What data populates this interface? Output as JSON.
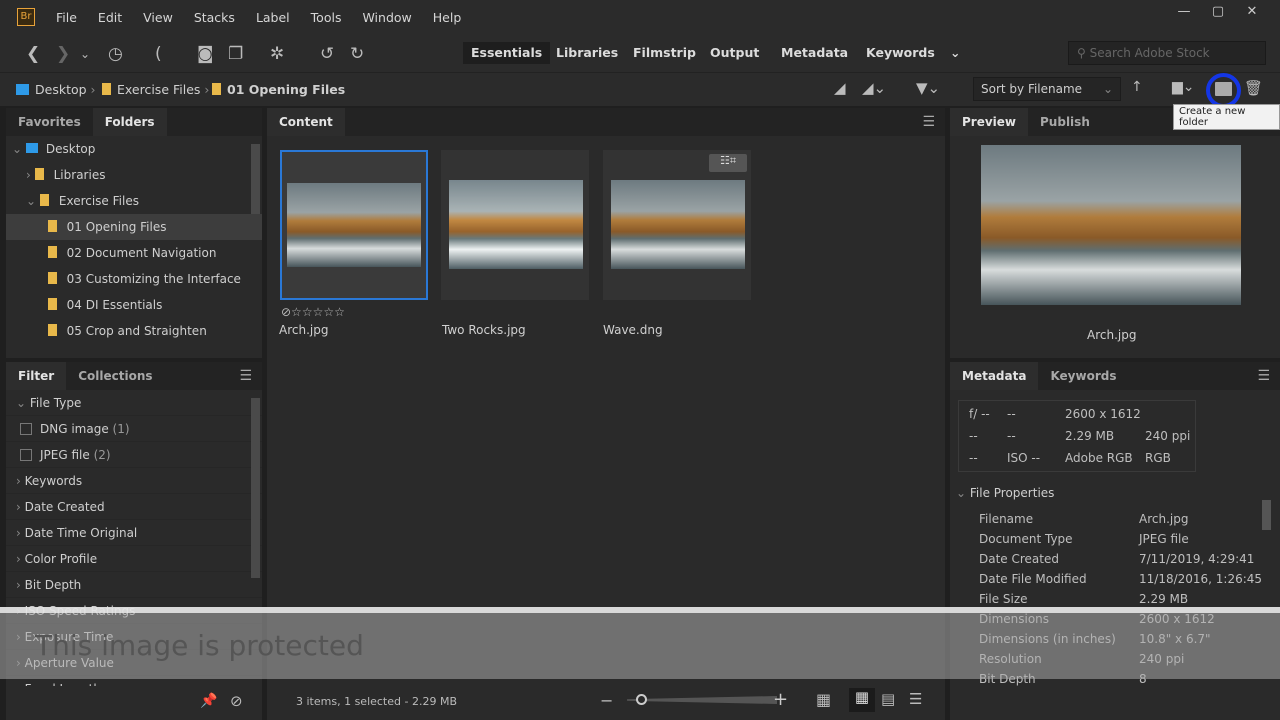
{
  "app": {
    "logo": "Br",
    "menu": [
      "File",
      "Edit",
      "View",
      "Stacks",
      "Label",
      "Tools",
      "Window",
      "Help"
    ]
  },
  "window_controls": {
    "minimize": "—",
    "maximize": "▢",
    "close": "✕"
  },
  "toolbar": {
    "workspaces": [
      "Essentials",
      "Libraries",
      "Filmstrip",
      "Output",
      "Metadata",
      "Keywords"
    ],
    "active_workspace": "Essentials",
    "search_placeholder": "Search Adobe Stock"
  },
  "breadcrumb": [
    "Desktop",
    "Exercise Files",
    "01 Opening Files"
  ],
  "sort": {
    "label": "Sort by Filename"
  },
  "tooltip": "Create a new folder",
  "left_panel": {
    "tabs": [
      "Favorites",
      "Folders"
    ],
    "active_tab": "Folders",
    "tree": [
      {
        "label": "Desktop",
        "level": 0,
        "expanded": true
      },
      {
        "label": "Libraries",
        "level": 1
      },
      {
        "label": "Exercise Files",
        "level": 1,
        "expanded": true
      },
      {
        "label": "01 Opening Files",
        "level": 2,
        "selected": true
      },
      {
        "label": "02 Document Navigation",
        "level": 2
      },
      {
        "label": "03 Customizing the Interface",
        "level": 2
      },
      {
        "label": "04 DI Essentials",
        "level": 2
      },
      {
        "label": "05 Crop and Straighten",
        "level": 2
      }
    ],
    "filter_tabs": [
      "Filter",
      "Collections"
    ],
    "filter_heading": "File Type",
    "file_types": [
      {
        "label": "DNG image",
        "count": "(1)"
      },
      {
        "label": "JPEG file",
        "count": "(2)"
      }
    ],
    "filter_groups": [
      "Keywords",
      "Date Created",
      "Date Time Original",
      "Color Profile",
      "Bit Depth",
      "ISO Speed Ratings",
      "Exposure Time",
      "Aperture Value",
      "Focal Length"
    ]
  },
  "content": {
    "title": "Content",
    "items": [
      {
        "name": "Arch.jpg",
        "selected": true,
        "rating": 0
      },
      {
        "name": "Two Rocks.jpg"
      },
      {
        "name": "Wave.dng",
        "badge": "adjusted-crop"
      }
    ],
    "status": "3 items, 1 selected - 2.29 MB",
    "thumbnail_size": 0.1
  },
  "preview": {
    "tabs": [
      "Preview",
      "Publish"
    ],
    "caption": "Arch.jpg"
  },
  "metadata": {
    "tabs": [
      "Metadata",
      "Keywords"
    ],
    "placard": {
      "aperture": "f/ --",
      "shutter": "--",
      "c1": "--",
      "c2": "--",
      "c3": "--",
      "iso": "ISO --",
      "dimensions": "2600 x 1612",
      "size": "2.29 MB",
      "resolution": "240 ppi",
      "profile": "Adobe RGB",
      "mode": "RGB"
    },
    "section": "File Properties",
    "props": [
      [
        "Filename",
        "Arch.jpg"
      ],
      [
        "Document Type",
        "JPEG file"
      ],
      [
        "Date Created",
        "7/11/2019, 4:29:41"
      ],
      [
        "Date File Modified",
        "11/18/2016, 1:26:45"
      ],
      [
        "File Size",
        "2.29 MB"
      ],
      [
        "Dimensions",
        "2600 x 1612"
      ],
      [
        "Dimensions (in inches)",
        "10.8\" x 6.7\""
      ],
      [
        "Resolution",
        "240 ppi"
      ],
      [
        "Bit Depth",
        "8"
      ]
    ]
  },
  "overlay": {
    "text": "This image is protected"
  }
}
